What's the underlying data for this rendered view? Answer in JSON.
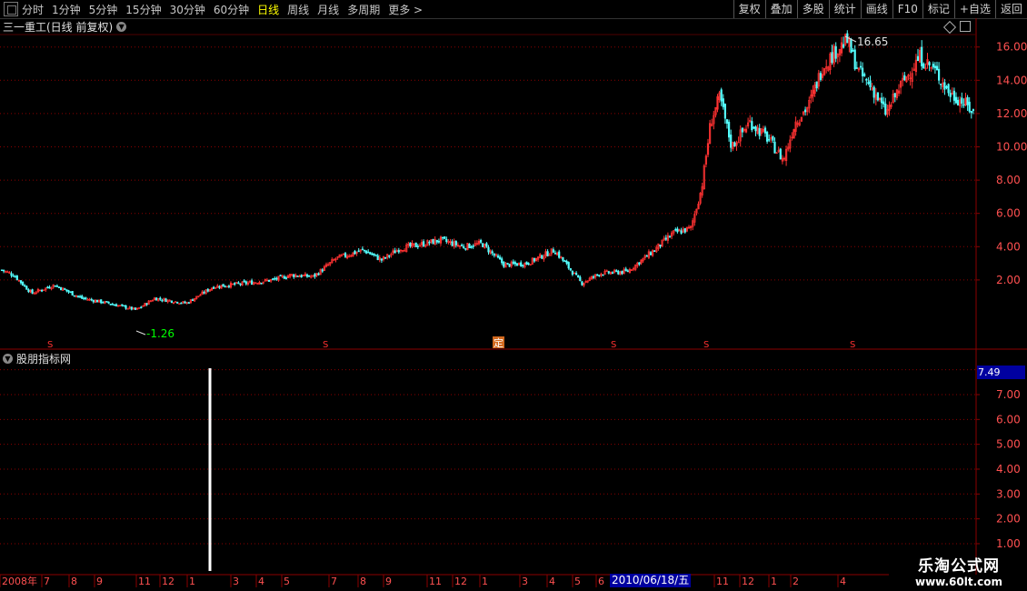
{
  "toolbar": {
    "periods": [
      "分时",
      "1分钟",
      "5分钟",
      "15分钟",
      "30分钟",
      "60分钟",
      "日线",
      "周线",
      "月线",
      "多周期",
      "更多 >"
    ],
    "active_period": "日线",
    "right_buttons": [
      "复权",
      "叠加",
      "多股",
      "统计",
      "画线",
      "F10",
      "标记",
      "+自选",
      "返回"
    ]
  },
  "chart": {
    "title": "三一重工(日线 前复权)",
    "high_label": "16.65",
    "low_label": "-1.26",
    "price_axis": [
      "16.00",
      "14.00",
      "12.00",
      "10.00",
      "8.00",
      "6.00",
      "4.00",
      "2.00"
    ],
    "markers": [
      "S",
      "S",
      "定",
      "S",
      "S",
      "S"
    ]
  },
  "indicator": {
    "title": "股朋指标网",
    "current_value": "7.49",
    "axis": [
      "7.00",
      "6.00",
      "5.00",
      "4.00",
      "3.00",
      "2.00",
      "1.00"
    ]
  },
  "date_axis": {
    "labels": [
      "2008年",
      "7",
      "8",
      "9",
      "11",
      "12",
      "1",
      "3",
      "4",
      "5",
      "7",
      "8",
      "9",
      "11",
      "12",
      "1",
      "3",
      "4",
      "5",
      "6",
      "11",
      "12",
      "1",
      "2",
      "4"
    ],
    "selected_date": "2010/06/18/五"
  },
  "watermark": {
    "line1": "乐淘公式网",
    "line2": "www.60lt.com"
  },
  "colors": {
    "up": "#ff3232",
    "down": "#54ffff",
    "grid": "#8b0000",
    "axis_text": "#ff5050"
  }
}
